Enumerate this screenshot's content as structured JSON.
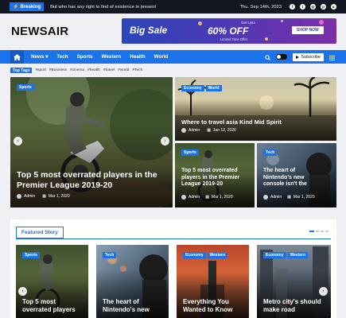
{
  "topbar": {
    "breaking_label": "Breaking",
    "ticker": "But who has any right to find of existence in present",
    "date": "Thu. Sep 14th, 2023",
    "social_icons": [
      "facebook-icon",
      "twitter-icon",
      "instagram-icon",
      "pinterest-icon",
      "youtube-icon"
    ]
  },
  "header": {
    "logo": "NEWSAIR",
    "ad": {
      "title": "Big Sale",
      "upto": "Get Upto",
      "percent": "60% OFF",
      "limited": "Limited Time Offer",
      "button": "SHOP NOW"
    }
  },
  "nav": {
    "items": [
      "News",
      "Tech",
      "Sports",
      "Western",
      "Health",
      "World"
    ],
    "subscribe": "Subscribe"
  },
  "tags": {
    "label": "Top Tags",
    "items": [
      "#sport",
      "#Business",
      "#cinema",
      "#health",
      "#travel",
      "#world",
      "#Tech"
    ]
  },
  "hero": {
    "main": {
      "badge": "Sports",
      "title": "Top 5 most overrated players in the Premier League 2019-20",
      "author": "Admin",
      "date": "Mar 1, 2020"
    },
    "top_right": {
      "badges": [
        "Economy",
        "World"
      ],
      "title": "Where to travel asia Kind Mid Spirit",
      "author": "Admin",
      "date": "Jan 12, 2020"
    },
    "bottom_left": {
      "badge": "Sports",
      "title": "Top 5 most overrated players in the Premier League 2019-20",
      "author": "Admin",
      "date": "Mar 1, 2020"
    },
    "bottom_right": {
      "badge": "Tech",
      "title": "The heart of Nintendo's new console isn't the",
      "author": "Admin",
      "date": "Mar 1, 2020"
    }
  },
  "featured": {
    "heading": "Featured Story",
    "cards": [
      {
        "badges": [
          "Sports"
        ],
        "title": "Top 5 most overrated players"
      },
      {
        "badges": [
          "Tech"
        ],
        "title": "The heart of Nintendo's new"
      },
      {
        "badges": [
          "Economy",
          "Western"
        ],
        "title": "Everything You Wanted to Know"
      },
      {
        "badges": [
          "Economy",
          "Western"
        ],
        "title": "Metro city's should make road"
      }
    ]
  }
}
